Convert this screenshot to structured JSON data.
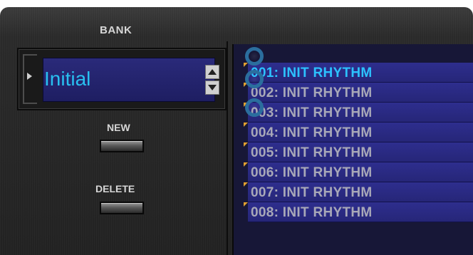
{
  "bank": {
    "label": "BANK",
    "value": "Initial"
  },
  "buttons": {
    "new_label": "NEW",
    "delete_label": "DELETE"
  },
  "list": {
    "rows": [
      {
        "label": "001: INIT RHYTHM",
        "selected": true
      },
      {
        "label": "002: INIT RHYTHM",
        "selected": false
      },
      {
        "label": "003: INIT RHYTHM",
        "selected": false
      },
      {
        "label": "004: INIT RHYTHM",
        "selected": false
      },
      {
        "label": "005: INIT RHYTHM",
        "selected": false
      },
      {
        "label": "006: INIT RHYTHM",
        "selected": false
      },
      {
        "label": "007: INIT RHYTHM",
        "selected": false
      },
      {
        "label": "008: INIT RHYTHM",
        "selected": false
      }
    ]
  },
  "icons": {
    "bank_arrow": "play-right-icon",
    "stepper_up": "triangle-up-icon",
    "stepper_down": "triangle-down-icon",
    "row_marker": "orange-corner-marker",
    "highlight_ring": "blue-circle-highlight"
  },
  "colors": {
    "selected_text": "#2cc2ff",
    "row_text": "#a8a8b8",
    "row_bg": "#2e2e8e",
    "marker": "#e0a030",
    "ring": "#2b6e9e"
  }
}
